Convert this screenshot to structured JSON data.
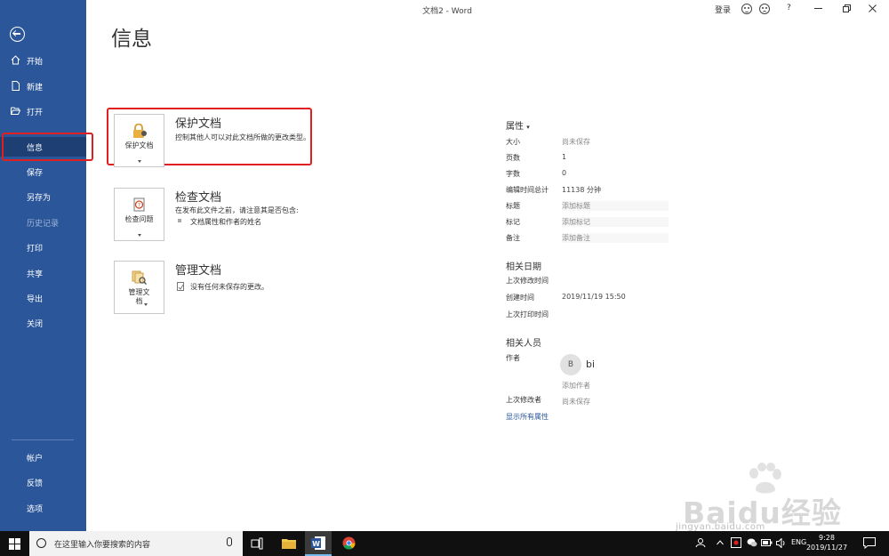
{
  "window": {
    "title": "文档2 - Word",
    "login": "登录",
    "help": "?"
  },
  "sidebar": {
    "items": [
      {
        "label": "开始"
      },
      {
        "label": "新建"
      },
      {
        "label": "打开"
      },
      {
        "label": "信息"
      },
      {
        "label": "保存"
      },
      {
        "label": "另存为"
      },
      {
        "label": "历史记录"
      },
      {
        "label": "打印"
      },
      {
        "label": "共享"
      },
      {
        "label": "导出"
      },
      {
        "label": "关闭"
      }
    ],
    "bottom": [
      {
        "label": "帐户"
      },
      {
        "label": "反馈"
      },
      {
        "label": "选项"
      }
    ]
  },
  "page": {
    "title": "信息"
  },
  "cards": {
    "protect": {
      "button": "保护文档",
      "title": "保护文档",
      "desc": "控制其他人可以对此文档所做的更改类型。"
    },
    "inspect": {
      "button": "检查问题",
      "title": "检查文档",
      "desc": "在发布此文件之前，请注意其是否包含:",
      "bullet": "文档属性和作者的姓名"
    },
    "manage": {
      "button_line1": "管理文",
      "button_line2": "档",
      "title": "管理文档",
      "desc": "没有任何未保存的更改。"
    }
  },
  "properties": {
    "heading": "属性",
    "rows": [
      {
        "label": "大小",
        "value": "尚未保存"
      },
      {
        "label": "页数",
        "value": "1"
      },
      {
        "label": "字数",
        "value": "0"
      },
      {
        "label": "编辑时间总计",
        "value": "11138 分钟"
      },
      {
        "label": "标题",
        "value": "添加标题"
      },
      {
        "label": "标记",
        "value": "添加标记"
      },
      {
        "label": "备注",
        "value": "添加备注"
      }
    ],
    "dates_heading": "相关日期",
    "dates": [
      {
        "label": "上次修改时间",
        "value": ""
      },
      {
        "label": "创建时间",
        "value": "2019/11/19 15:50"
      },
      {
        "label": "上次打印时间",
        "value": ""
      }
    ],
    "people_heading": "相关人员",
    "author_label": "作者",
    "author_initial": "B",
    "author_name": "bi",
    "add_author": "添加作者",
    "last_modified_by_label": "上次修改者",
    "last_modified_by_value": "尚未保存",
    "show_all": "显示所有属性"
  },
  "watermark": {
    "text": "Baidu经验",
    "sub": "jingyan.baidu.com"
  },
  "taskbar": {
    "search_placeholder": "在这里输入你要搜索的内容",
    "lang": "ENG",
    "time": "9:28",
    "date": "2019/11/27"
  }
}
